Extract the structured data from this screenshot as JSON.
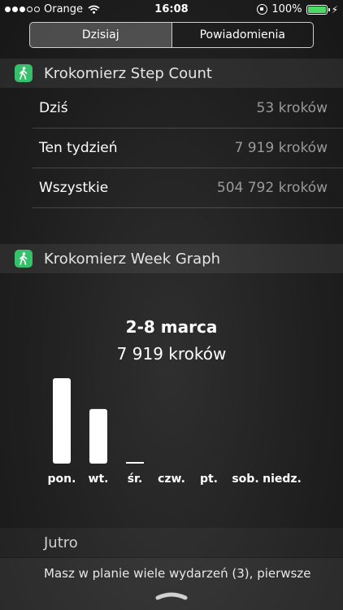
{
  "status_bar": {
    "carrier": "Orange",
    "time": "16:08",
    "battery": "100%",
    "signal_bars": 3
  },
  "segments": [
    {
      "label": "Dzisiaj",
      "selected": true
    },
    {
      "label": "Powiadomienia",
      "selected": false
    }
  ],
  "step_count_widget": {
    "title": "Krokomierz Step Count",
    "rows": [
      {
        "label": "Dziś",
        "value": "53 kroków"
      },
      {
        "label": "Ten tydzień",
        "value": "7 919 kroków"
      },
      {
        "label": "Wszystkie",
        "value": "504 792 kroków"
      }
    ]
  },
  "week_graph_widget": {
    "title": "Krokomierz Week Graph",
    "range": "2-8 marca",
    "total": "7 919 kroków"
  },
  "chart_data": {
    "type": "bar",
    "categories": [
      "pon.",
      "wt.",
      "śr.",
      "czw.",
      "pt.",
      "sob.",
      "niedz."
    ],
    "values": [
      4800,
      3066,
      53,
      0,
      0,
      0,
      0
    ]
  },
  "calendar": {
    "header": "Jutro",
    "text": "Masz w planie wiele wydarzeń (3), pierwsze"
  },
  "colors": {
    "accent_green": "#35c16c",
    "battery_green": "#4cd964"
  }
}
